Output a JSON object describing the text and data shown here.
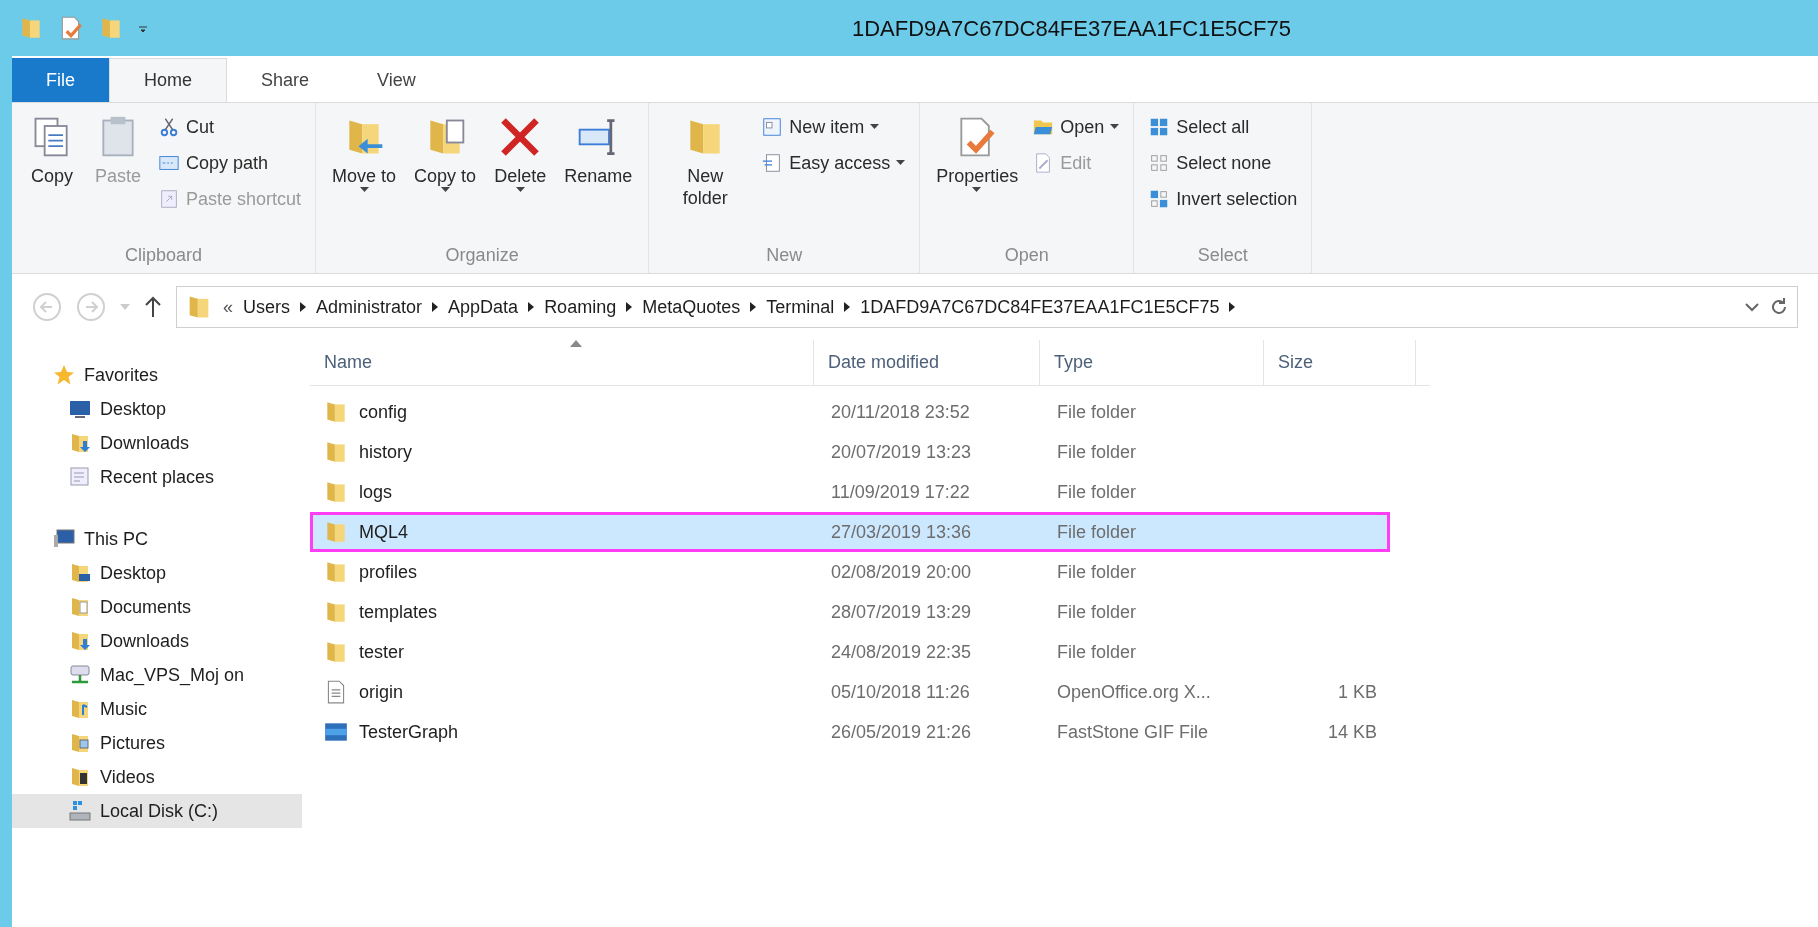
{
  "window": {
    "title": "1DAFD9A7C67DC84FE37EAA1FC1E5CF75"
  },
  "quick_access": [
    {
      "kind": "folder"
    },
    {
      "kind": "properties"
    },
    {
      "kind": "newfolder"
    },
    {
      "kind": "caret"
    }
  ],
  "tabs": [
    {
      "label": "File",
      "kind": "file",
      "selected": false
    },
    {
      "label": "Home",
      "kind": "tab",
      "selected": true
    },
    {
      "label": "Share",
      "kind": "tab",
      "selected": false
    },
    {
      "label": "View",
      "kind": "tab",
      "selected": false
    }
  ],
  "ribbon": [
    {
      "label": "Clipboard",
      "columns": [
        {
          "kind": "large",
          "items": [
            {
              "label": "Copy",
              "kind": "copy",
              "disabled": false,
              "dropdown": false
            }
          ]
        },
        {
          "kind": "large",
          "items": [
            {
              "label": "Paste",
              "kind": "paste",
              "disabled": true,
              "dropdown": false
            }
          ]
        },
        {
          "kind": "small",
          "items": [
            {
              "label": "Cut",
              "kind": "cut",
              "disabled": false,
              "dropdown": false
            },
            {
              "label": "Copy path",
              "kind": "copypath",
              "disabled": false,
              "dropdown": false
            },
            {
              "label": "Paste shortcut",
              "kind": "pasteshortcut",
              "disabled": true,
              "dropdown": false
            }
          ]
        }
      ]
    },
    {
      "label": "Organize",
      "columns": [
        {
          "kind": "large",
          "items": [
            {
              "label": "Move to",
              "kind": "moveto",
              "disabled": false,
              "dropdown": true
            }
          ]
        },
        {
          "kind": "large",
          "items": [
            {
              "label": "Copy to",
              "kind": "copyto",
              "disabled": false,
              "dropdown": true
            }
          ]
        },
        {
          "kind": "large",
          "items": [
            {
              "label": "Delete",
              "kind": "delete",
              "disabled": false,
              "dropdown": true
            }
          ]
        },
        {
          "kind": "large",
          "items": [
            {
              "label": "Rename",
              "kind": "rename",
              "disabled": false,
              "dropdown": false
            }
          ]
        }
      ]
    },
    {
      "label": "New",
      "columns": [
        {
          "kind": "large",
          "items": [
            {
              "label": "New folder",
              "kind": "newfolder",
              "disabled": false,
              "dropdown": false
            }
          ]
        },
        {
          "kind": "small",
          "items": [
            {
              "label": "New item",
              "kind": "newitem",
              "disabled": false,
              "dropdown": true
            },
            {
              "label": "Easy access",
              "kind": "easyaccess",
              "disabled": false,
              "dropdown": true
            }
          ]
        }
      ]
    },
    {
      "label": "Open",
      "columns": [
        {
          "kind": "large",
          "items": [
            {
              "label": "Properties",
              "kind": "properties",
              "disabled": false,
              "dropdown": true
            }
          ]
        },
        {
          "kind": "small",
          "items": [
            {
              "label": "Open",
              "kind": "open",
              "disabled": false,
              "dropdown": true
            },
            {
              "label": "Edit",
              "kind": "edit",
              "disabled": true,
              "dropdown": false
            }
          ]
        }
      ]
    },
    {
      "label": "Select",
      "columns": [
        {
          "kind": "small",
          "items": [
            {
              "label": "Select all",
              "kind": "selectall",
              "disabled": false,
              "dropdown": false
            },
            {
              "label": "Select none",
              "kind": "selectnone",
              "disabled": false,
              "dropdown": false
            },
            {
              "label": "Invert selection",
              "kind": "invert",
              "disabled": false,
              "dropdown": false
            }
          ]
        }
      ]
    }
  ],
  "address_bar": {
    "overflow": "«",
    "crumbs": [
      "Users",
      "Administrator",
      "AppData",
      "Roaming",
      "MetaQuotes",
      "Terminal",
      "1DAFD9A7C67DC84FE37EAA1FC1E5CF75"
    ]
  },
  "sidebar": {
    "items": [
      {
        "label": "Favorites",
        "kind": "star",
        "selected": false,
        "children": [
          {
            "label": "Desktop",
            "kind": "desktop",
            "selected": false
          },
          {
            "label": "Downloads",
            "kind": "downloads",
            "selected": false
          },
          {
            "label": "Recent places",
            "kind": "recent",
            "selected": false
          }
        ]
      },
      {
        "label": "This PC",
        "kind": "pc",
        "selected": false,
        "children": [
          {
            "label": "Desktop",
            "kind": "desktopfolder",
            "selected": false
          },
          {
            "label": "Documents",
            "kind": "documents",
            "selected": false
          },
          {
            "label": "Downloads",
            "kind": "downloads",
            "selected": false
          },
          {
            "label": "Mac_VPS_Moj on",
            "kind": "network",
            "selected": false
          },
          {
            "label": "Music",
            "kind": "music",
            "selected": false
          },
          {
            "label": "Pictures",
            "kind": "pictures",
            "selected": false
          },
          {
            "label": "Videos",
            "kind": "videos",
            "selected": false
          },
          {
            "label": "Local Disk (C:)",
            "kind": "disk",
            "selected": true
          }
        ]
      }
    ]
  },
  "table": {
    "columns": [
      "Name",
      "Date modified",
      "Type",
      "Size"
    ],
    "rows": [
      {
        "name": "config",
        "date": "20/11/2018 23:52",
        "type": "File folder",
        "kind": "folder",
        "selected": false,
        "annotated": false
      },
      {
        "name": "history",
        "date": "20/07/2019 13:23",
        "type": "File folder",
        "kind": "folder",
        "selected": false,
        "annotated": false
      },
      {
        "name": "logs",
        "date": "11/09/2019 17:22",
        "type": "File folder",
        "kind": "folder",
        "selected": false,
        "annotated": false
      },
      {
        "name": "MQL4",
        "date": "27/03/2019 13:36",
        "type": "File folder",
        "kind": "folder",
        "selected": true,
        "annotated": true
      },
      {
        "name": "profiles",
        "date": "02/08/2019 20:00",
        "type": "File folder",
        "kind": "folder",
        "selected": false,
        "annotated": false
      },
      {
        "name": "templates",
        "date": "28/07/2019 13:29",
        "type": "File folder",
        "kind": "folder",
        "selected": false,
        "annotated": false
      },
      {
        "name": "tester",
        "date": "24/08/2019 22:35",
        "type": "File folder",
        "kind": "folder",
        "selected": false,
        "annotated": false
      },
      {
        "name": "origin",
        "date": "05/10/2018 11:26",
        "type": "OpenOffice.org X...",
        "size": "1 KB",
        "kind": "text",
        "selected": false,
        "annotated": false
      },
      {
        "name": "TesterGraph",
        "date": "26/05/2019 21:26",
        "type": "FastStone GIF File",
        "size": "14 KB",
        "kind": "gif",
        "selected": false,
        "annotated": false
      }
    ]
  }
}
